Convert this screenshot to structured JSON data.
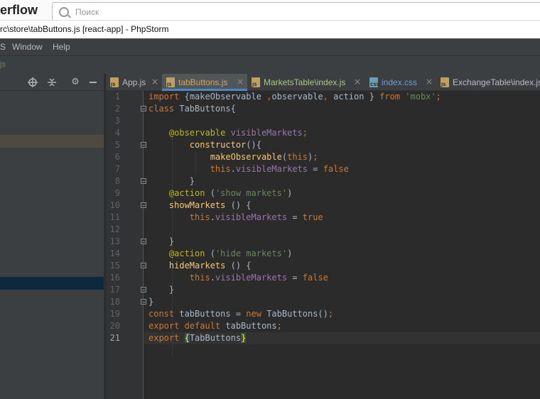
{
  "browser": {
    "site_partial": "erflow",
    "search_placeholder": "Поиск"
  },
  "window": {
    "title": "rc\\store\\tabButtons.js [react-app] - PhpStorm"
  },
  "menu": {
    "items": [
      "S",
      "Window",
      "Help"
    ]
  },
  "navbar": {
    "crumb": "js"
  },
  "project_panel": {
    "icons": [
      "crosshair-icon",
      "collapse-icon",
      "gear-icon",
      "minimize-icon"
    ]
  },
  "tabs": [
    {
      "label": "App.js",
      "type": "js",
      "active": false,
      "closable": true
    },
    {
      "label": "tabButtons.js",
      "type": "js",
      "active": true,
      "closable": true
    },
    {
      "label": "MarketsTable\\index.js",
      "type": "js",
      "active": false,
      "closable": true
    },
    {
      "label": "index.css",
      "type": "css",
      "active": false,
      "closable": true
    },
    {
      "label": "ExchangeTable\\index.js",
      "type": "js",
      "active": false,
      "closable": false
    }
  ],
  "editor": {
    "current_line": 21,
    "lines": [
      [
        [
          "kw",
          "import "
        ],
        [
          "",
          "{"
        ],
        [
          "",
          "makeObservable "
        ],
        [
          "kw",
          ","
        ],
        [
          "",
          "observable"
        ],
        [
          "kw",
          ", "
        ],
        [
          "",
          "action "
        ],
        [
          "",
          "} "
        ],
        [
          "kw",
          "from "
        ],
        [
          "str",
          "'mobx'"
        ],
        [
          "kw",
          ";"
        ]
      ],
      [
        [
          "kw",
          "class "
        ],
        [
          "",
          "TabButtons{"
        ]
      ],
      [],
      [
        [
          "",
          "    "
        ],
        [
          "ann",
          "@observable "
        ],
        [
          "fld",
          "visibleMarkets"
        ],
        [
          "kw",
          ";"
        ]
      ],
      [
        [
          "",
          "        "
        ],
        [
          "fn",
          "constructor"
        ],
        [
          "",
          "(){"
        ]
      ],
      [
        [
          "",
          "            "
        ],
        [
          "fn",
          "makeObservable"
        ],
        [
          "",
          "("
        ],
        [
          "kw",
          "this"
        ],
        [
          "",
          ")"
        ],
        [
          "kw",
          ";"
        ]
      ],
      [
        [
          "",
          "            "
        ],
        [
          "kw",
          "this"
        ],
        [
          "",
          "."
        ],
        [
          "fld",
          "visibleMarkets"
        ],
        [
          "",
          " = "
        ],
        [
          "kw",
          "false"
        ]
      ],
      [
        [
          "",
          "        "
        ],
        [
          "",
          "}"
        ]
      ],
      [
        [
          "",
          "    "
        ],
        [
          "ann",
          "@action "
        ],
        [
          "",
          "("
        ],
        [
          "str",
          "'show markets'"
        ],
        [
          "",
          ")"
        ]
      ],
      [
        [
          "",
          "    "
        ],
        [
          "fn",
          "showMarkets "
        ],
        [
          "",
          "() {"
        ]
      ],
      [
        [
          "",
          "        "
        ],
        [
          "kw",
          "this"
        ],
        [
          "",
          "."
        ],
        [
          "fld",
          "visibleMarkets"
        ],
        [
          "",
          " = "
        ],
        [
          "kw",
          "true"
        ]
      ],
      [],
      [
        [
          "",
          "    "
        ],
        [
          "",
          "}"
        ]
      ],
      [
        [
          "",
          "    "
        ],
        [
          "ann",
          "@action "
        ],
        [
          "",
          "("
        ],
        [
          "str",
          "'hide markets'"
        ],
        [
          "",
          ")"
        ]
      ],
      [
        [
          "",
          "    "
        ],
        [
          "fn",
          "hideMarkets "
        ],
        [
          "",
          "() {"
        ]
      ],
      [
        [
          "",
          "        "
        ],
        [
          "kw",
          "this"
        ],
        [
          "",
          "."
        ],
        [
          "fld",
          "visibleMarkets"
        ],
        [
          "",
          " = "
        ],
        [
          "kw",
          "false"
        ]
      ],
      [
        [
          "",
          "    "
        ],
        [
          "",
          "}"
        ]
      ],
      [
        [
          "",
          "}"
        ]
      ],
      [
        [
          "kw",
          "const "
        ],
        [
          "",
          "tabButtons = "
        ],
        [
          "kw",
          "new "
        ],
        [
          "",
          "TabButtons()"
        ],
        [
          "kw",
          ";"
        ]
      ],
      [
        [
          "kw",
          "export default "
        ],
        [
          "",
          "tabButtons"
        ],
        [
          "kw",
          ";"
        ]
      ],
      [
        [
          "kw",
          "export "
        ],
        [
          "brace-match",
          "{"
        ],
        [
          "",
          "TabButtons"
        ],
        [
          "brace-match",
          "}"
        ]
      ]
    ],
    "fold_lines": [
      2,
      5,
      8,
      10,
      13,
      15,
      17,
      18
    ]
  }
}
